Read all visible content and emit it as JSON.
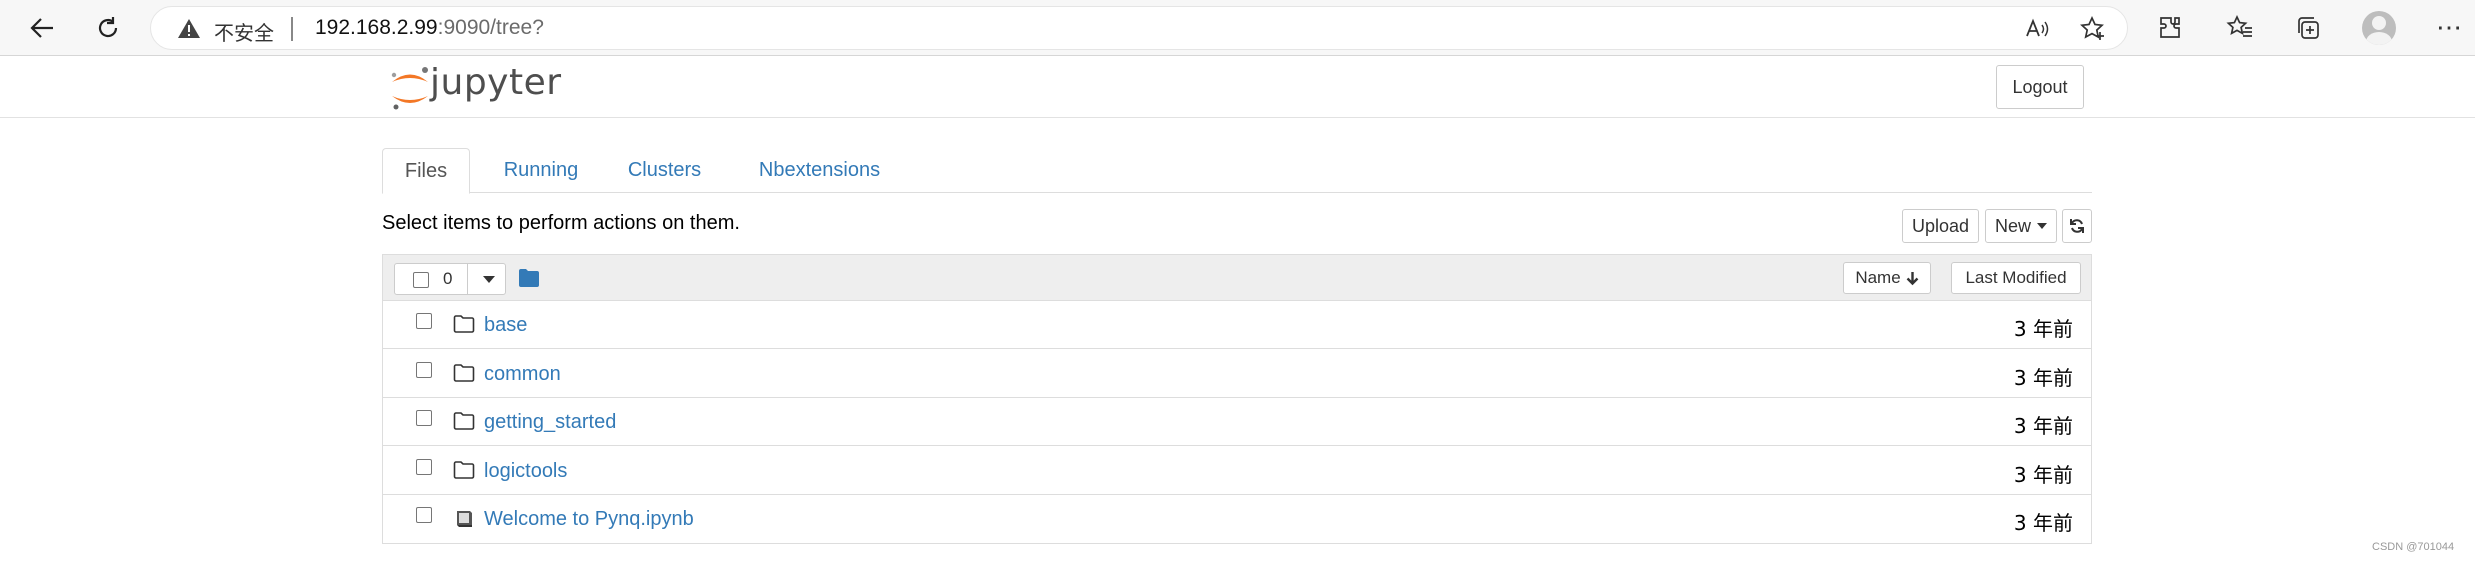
{
  "browser": {
    "security_label": "不安全",
    "url_host": "192.168.2.99",
    "url_rest": ":9090/tree?"
  },
  "header": {
    "logo_text": "jupyter",
    "logout_label": "Logout"
  },
  "tabs": [
    {
      "label": "Files",
      "active": true
    },
    {
      "label": "Running",
      "active": false
    },
    {
      "label": "Clusters",
      "active": false
    },
    {
      "label": "Nbextensions",
      "active": false
    }
  ],
  "toolbar": {
    "hint": "Select items to perform actions on them.",
    "upload_label": "Upload",
    "new_label": "New"
  },
  "list": {
    "selected_count": "0",
    "sort_name_label": "Name",
    "last_modified_label": "Last Modified",
    "items": [
      {
        "name": "base",
        "type": "folder",
        "modified": "3 年前"
      },
      {
        "name": "common",
        "type": "folder",
        "modified": "3 年前"
      },
      {
        "name": "getting_started",
        "type": "folder",
        "modified": "3 年前"
      },
      {
        "name": "logictools",
        "type": "folder",
        "modified": "3 年前"
      },
      {
        "name": "Welcome to Pynq.ipynb",
        "type": "notebook",
        "modified": "3 年前"
      }
    ]
  },
  "watermark": "CSDN @701044",
  "colors": {
    "link": "#337ab7",
    "jupyter_orange": "#f37726",
    "folder_blue": "#337ab7"
  }
}
